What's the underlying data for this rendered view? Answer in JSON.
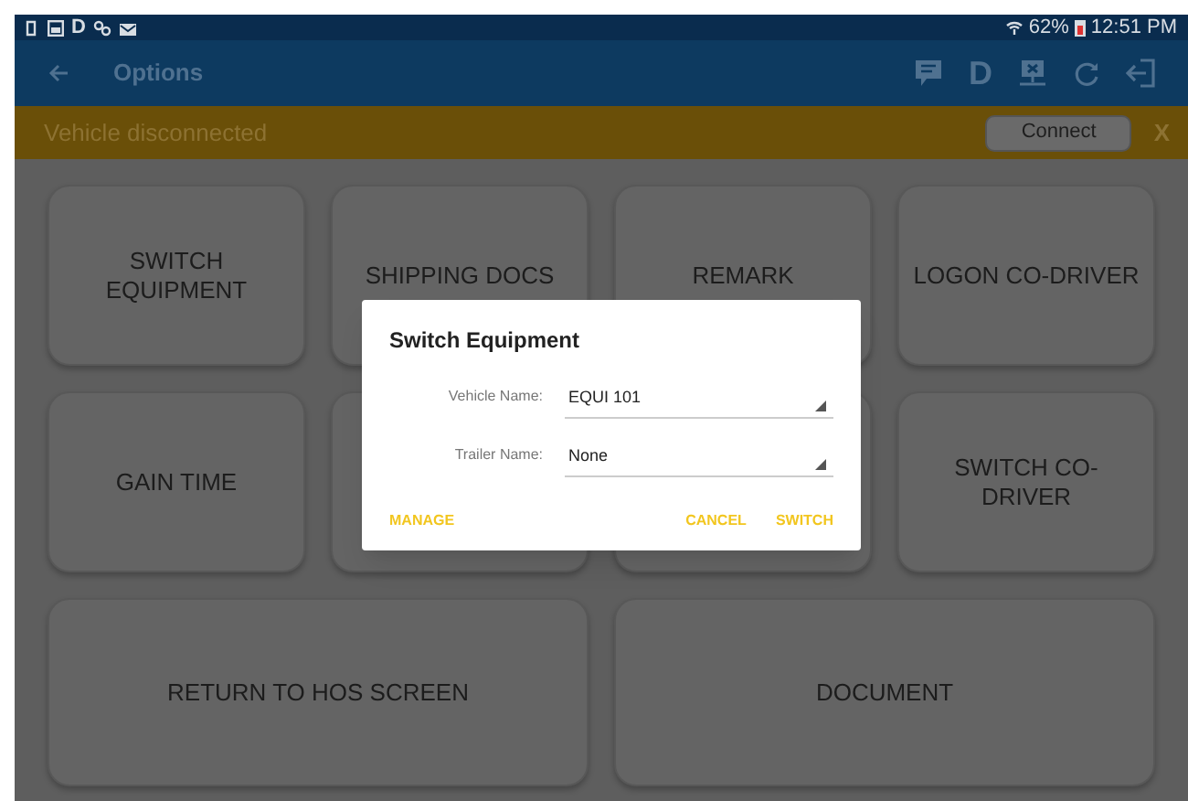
{
  "status_bar": {
    "left_letter": "D",
    "battery": "62%",
    "time": "12:51 PM"
  },
  "app_bar": {
    "title": "Options",
    "letter_icon": "D"
  },
  "banner": {
    "message": "Vehicle disconnected",
    "button": "Connect",
    "close": "X"
  },
  "tiles": [
    {
      "kind": "labeled",
      "label": "SWITCH EQUIPMENT"
    },
    {
      "kind": "labeled",
      "label": "SHIPPING DOCS"
    },
    {
      "kind": "labeled",
      "label": "REMARK"
    },
    {
      "kind": "labeled",
      "label": "LOGON CO-DRIVER"
    },
    {
      "kind": "labeled",
      "label": "GAIN TIME"
    },
    {
      "kind": "covered"
    },
    {
      "kind": "covered"
    },
    {
      "kind": "labeled",
      "label": "SWITCH CO-DRIVER"
    }
  ],
  "wide_tiles": [
    {
      "label": "RETURN TO HOS SCREEN"
    },
    {
      "label": "DOCUMENT"
    }
  ],
  "dialog": {
    "title": "Switch Equipment",
    "fields": [
      {
        "label": "Vehicle Name:",
        "value": "EQUI 101"
      },
      {
        "label": "Trailer Name:",
        "value": "None"
      }
    ],
    "left_buttons": [
      "MANAGE"
    ],
    "right_buttons": [
      "CANCEL",
      "SWITCH"
    ]
  }
}
